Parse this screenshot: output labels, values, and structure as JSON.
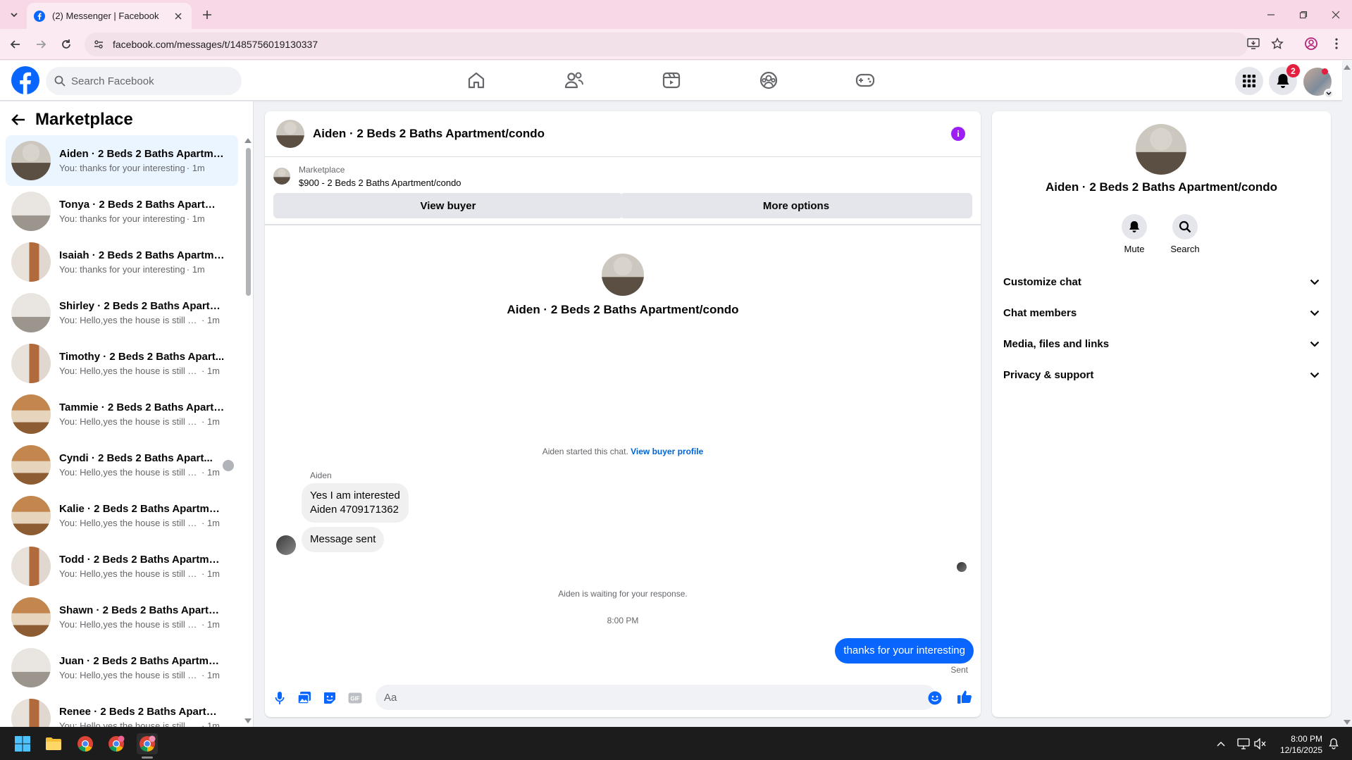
{
  "browser": {
    "tab_title": "(2) Messenger | Facebook",
    "url": "facebook.com/messages/t/1485756019130337"
  },
  "fb_header": {
    "search_placeholder": "Search Facebook",
    "notification_count": "2",
    "brand_color": "#0866ff"
  },
  "sidebar": {
    "title": "Marketplace",
    "conversations": [
      {
        "name": "Aiden · 2 Beds 2 Baths Apartme...",
        "preview": "You: thanks for your interesting",
        "time": "· 1m"
      },
      {
        "name": "Tonya · 2 Beds 2 Baths Apartme...",
        "preview": "You: thanks for your interesting",
        "time": "· 1m"
      },
      {
        "name": "Isaiah · 2 Beds 2 Baths Apartme...",
        "preview": "You: thanks for your interesting",
        "time": "· 1m"
      },
      {
        "name": "Shirley · 2 Beds 2 Baths Apartme...",
        "preview": "You: Hello,yes the house is still avai...",
        "time": "· 1m"
      },
      {
        "name": "Timothy · 2 Beds 2 Baths Apart...",
        "preview": "You: Hello,yes the house is still avai...",
        "time": "· 1m"
      },
      {
        "name": "Tammie · 2 Beds 2 Baths Apartm...",
        "preview": "You: Hello,yes the house is still avai...",
        "time": "· 1m"
      },
      {
        "name": "Cyndi · 2 Beds 2 Baths Apart...",
        "preview": "You: Hello,yes the house is still a...",
        "time": "· 1m"
      },
      {
        "name": "Kalie · 2 Beds 2 Baths Apartmen...",
        "preview": "You: Hello,yes the house is still avai...",
        "time": "· 1m"
      },
      {
        "name": "Todd · 2 Beds 2 Baths Apartmen...",
        "preview": "You: Hello,yes the house is still avai...",
        "time": "· 1m"
      },
      {
        "name": "Shawn · 2 Beds 2 Baths Apartme...",
        "preview": "You: Hello,yes the house is still avai...",
        "time": "· 1m"
      },
      {
        "name": "Juan · 2 Beds 2 Baths Apartment...",
        "preview": "You: Hello,yes the house is still avai...",
        "time": "· 1m"
      },
      {
        "name": "Renee · 2 Beds 2 Baths Apartme...",
        "preview": "You: Hello,yes the house is still avai...",
        "time": "· 1m"
      }
    ]
  },
  "chat": {
    "title": "Aiden · 2 Beds 2 Baths Apartment/condo",
    "listing_source": "Marketplace",
    "listing_price": "$900 - 2 Beds 2 Baths Apartment/condo",
    "view_buyer": "View buyer",
    "more_options": "More options",
    "intro_name": "Aiden · 2 Beds 2 Baths Apartment/condo",
    "started_text": "Aiden started this chat.",
    "view_buyer_profile": "View buyer profile",
    "sender": "Aiden",
    "msg1_line1": "Yes I am interested",
    "msg1_line2": "Aiden 4709171362",
    "msg2": "Message sent",
    "waiting": "Aiden is waiting for your response.",
    "timestamp": "8:00 PM",
    "outgoing": "thanks for your interesting",
    "sent_label": "Sent",
    "input_placeholder": "Aa"
  },
  "right_panel": {
    "name": "Aiden · 2 Beds 2 Baths Apartment/condo",
    "mute": "Mute",
    "search": "Search",
    "rows": [
      "Customize chat",
      "Chat members",
      "Media, files and links",
      "Privacy & support"
    ]
  },
  "taskbar": {
    "time": "8:00 PM",
    "date": "12/16/2025"
  }
}
